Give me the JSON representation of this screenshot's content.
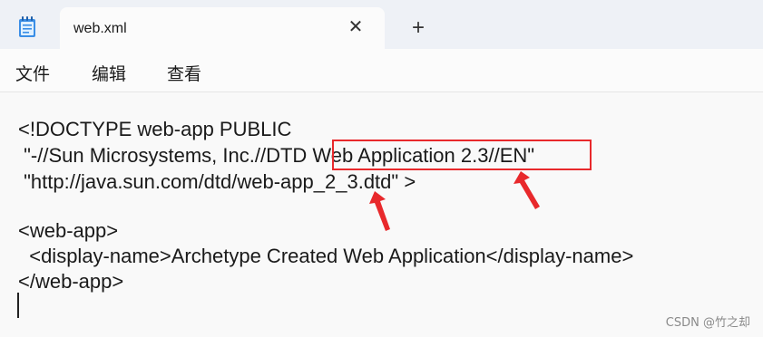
{
  "window": {
    "tab_title": "web.xml",
    "close_glyph": "✕",
    "new_tab_glyph": "+"
  },
  "menu": {
    "items": [
      "文件",
      "编辑",
      "查看"
    ]
  },
  "editor": {
    "lines": [
      "<!DOCTYPE web-app PUBLIC",
      " \"-//Sun Microsystems, Inc.//DTD Web Application 2.3//EN\"",
      " \"http://java.sun.com/dtd/web-app_2_3.dtd\" >",
      "",
      "<web-app>",
      "  <display-name>Archetype Created Web Application</display-name>",
      "</web-app>"
    ]
  },
  "annotations": {
    "highlight_color": "#e8292c",
    "highlighted_text": "Web Application 2.3//EN"
  },
  "watermark": "CSDN @竹之却"
}
